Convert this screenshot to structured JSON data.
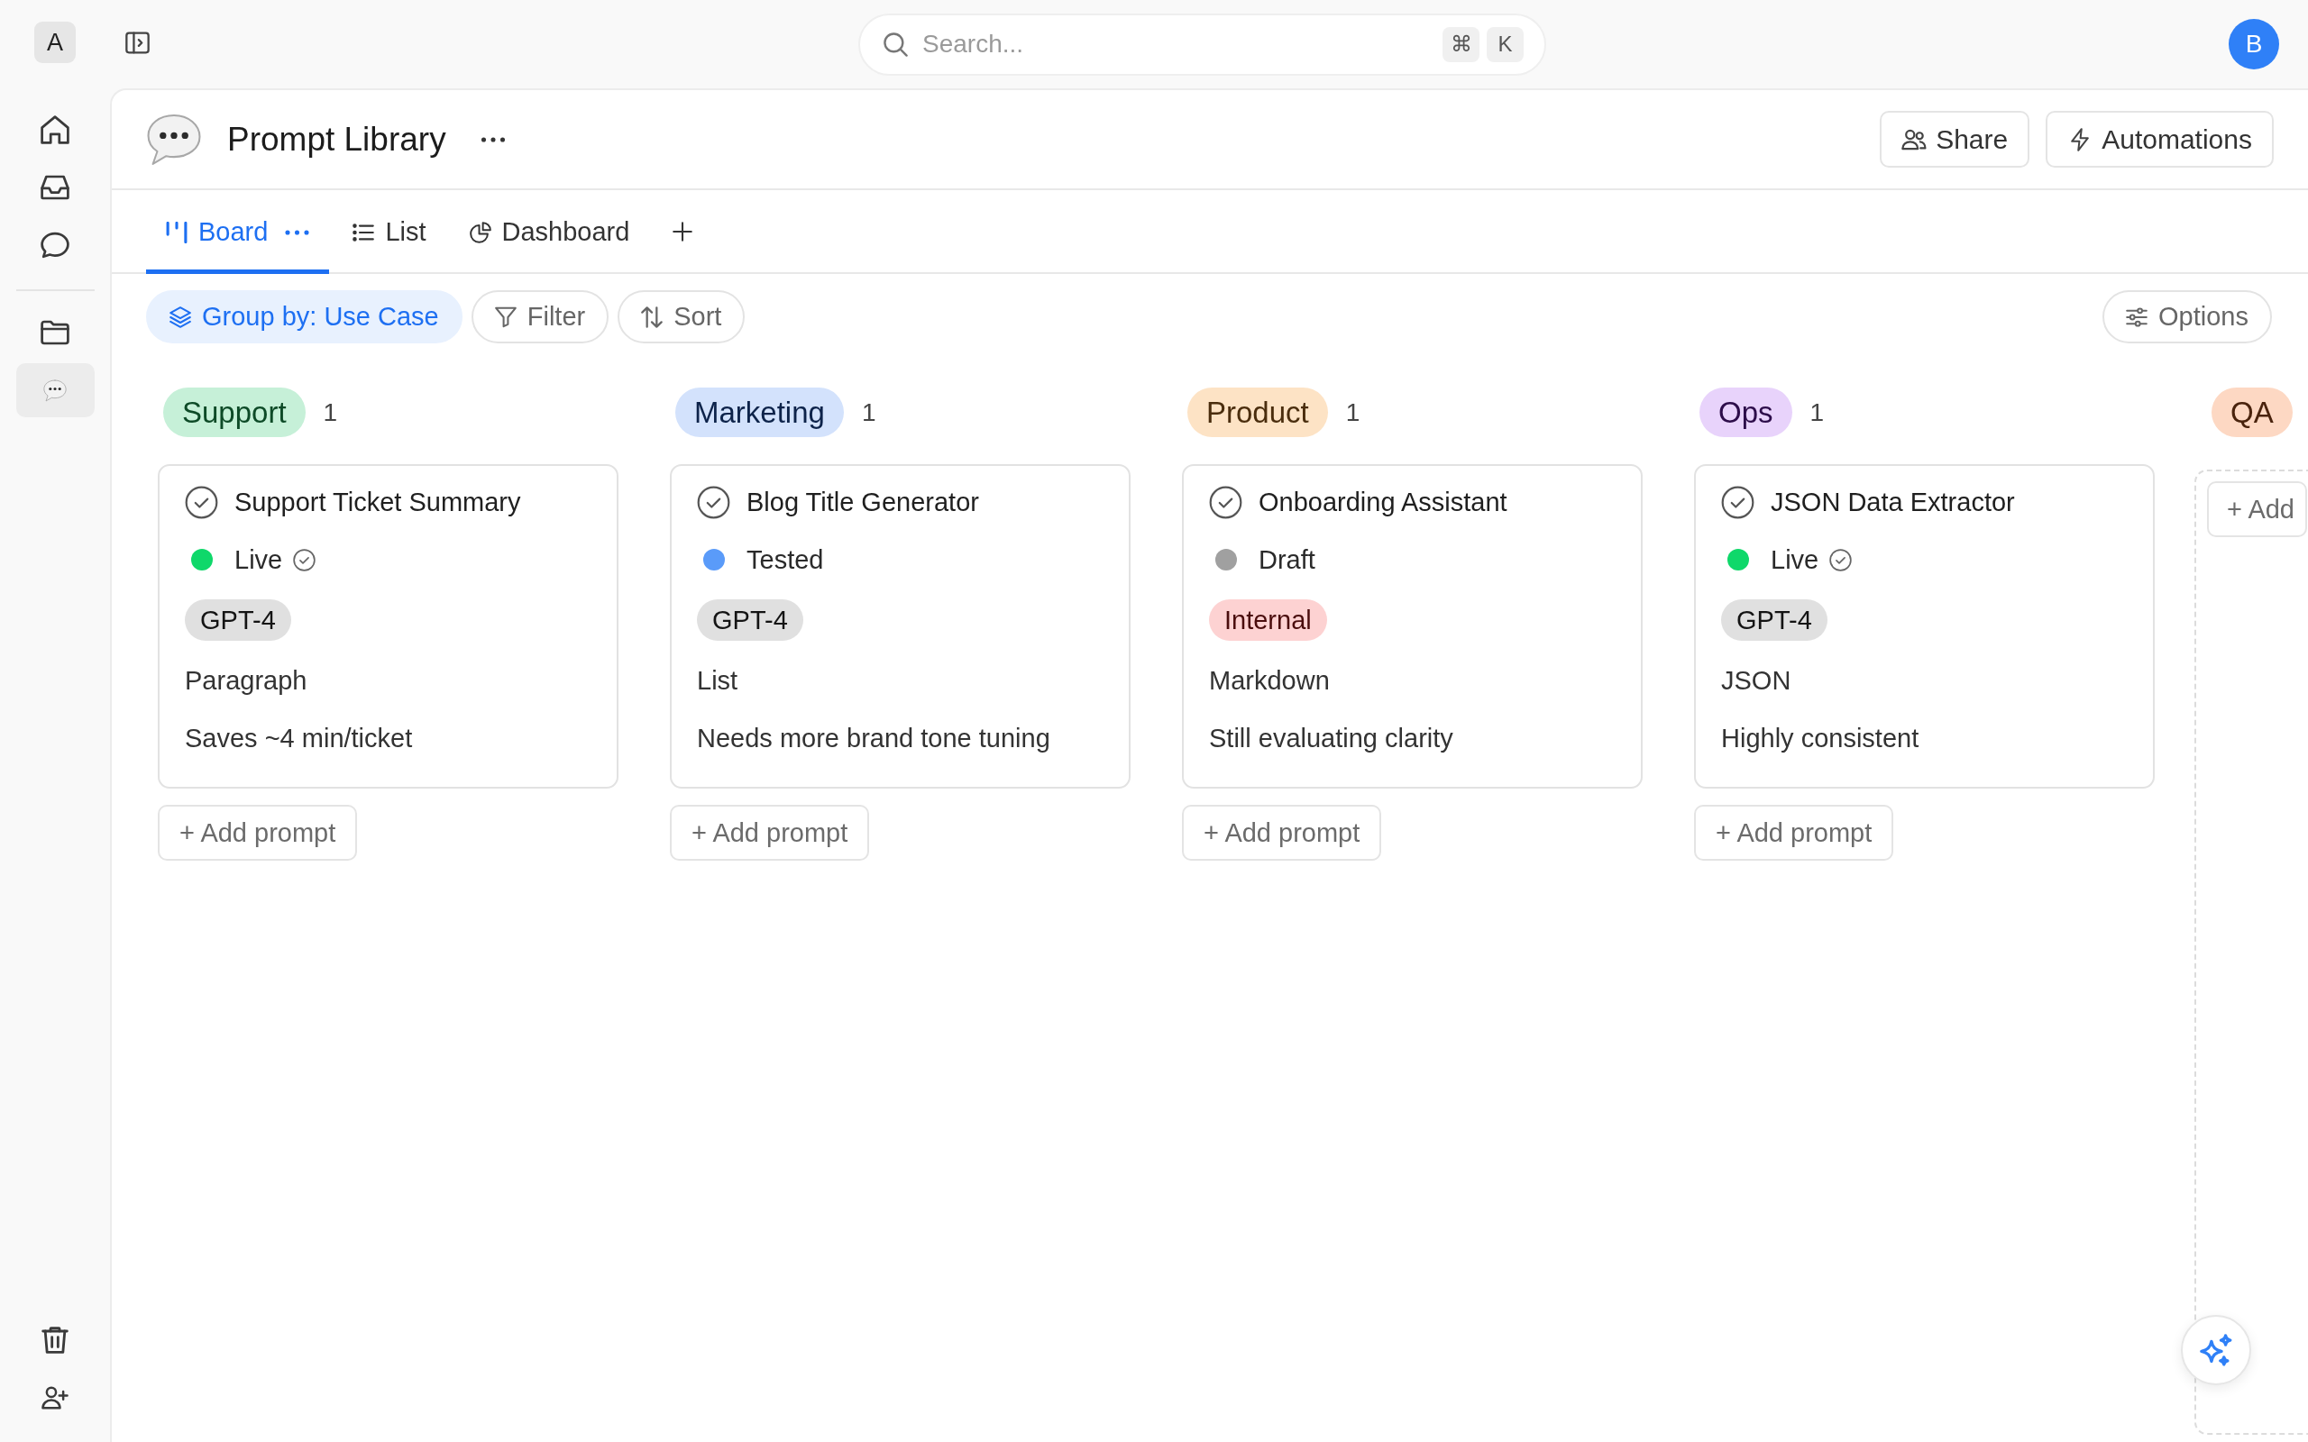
{
  "sidebar": {
    "avatar": "A",
    "nav": [
      {
        "selected": false
      },
      {
        "selected": false
      },
      {
        "selected": false
      },
      {
        "selected": false
      },
      {
        "selected": true
      }
    ]
  },
  "top_bar": {
    "search": {
      "placeholder": "Search...",
      "shortcut": [
        "⌘",
        "K"
      ]
    },
    "avatar": "B"
  },
  "page": {
    "title": "Prompt Library",
    "buttons": [
      "Share",
      "Automations"
    ]
  },
  "views": [
    {
      "label": "Board",
      "selected": true
    },
    {
      "label": "List",
      "selected": false
    },
    {
      "label": "Dashboard",
      "selected": false
    }
  ],
  "toolbar": {
    "group_by": "Group by: Use Case",
    "buttons": [
      "Filter",
      "Sort"
    ],
    "options": "Options"
  },
  "columns": [
    {
      "kind": "cards",
      "tag": "Support",
      "color": "#c6f0d8",
      "count": "1",
      "cards": [
        {
          "title": "Support Ticket Summary",
          "status": {
            "label": "Live",
            "color": "#0fd86a",
            "verified": true
          },
          "model": {
            "label": "GPT-4",
            "color": "#e0e0e0"
          },
          "format": "Paragraph",
          "note": "Saves ~4 min/ticket"
        }
      ],
      "add_button": "+ Add prompt"
    },
    {
      "kind": "cards",
      "tag": "Marketing",
      "color": "#d3e2fc",
      "count": "1",
      "cards": [
        {
          "title": "Blog Title Generator",
          "status": {
            "label": "Tested",
            "color": "#5a9bf9",
            "verified": false
          },
          "model": {
            "label": "GPT-4",
            "color": "#e0e0e0"
          },
          "format": "List",
          "note": "Needs more brand tone tuning"
        }
      ],
      "add_button": "+ Add prompt"
    },
    {
      "kind": "cards",
      "tag": "Product",
      "color": "#fde3c5",
      "count": "1",
      "cards": [
        {
          "title": "Onboarding Assistant",
          "status": {
            "label": "Draft",
            "color": "#a0a0a0",
            "verified": false
          },
          "model": {
            "label": "Internal",
            "color": "#fdd2d2"
          },
          "format": "Markdown",
          "note": "Still evaluating clarity"
        }
      ],
      "add_button": "+ Add prompt"
    },
    {
      "kind": "cards",
      "tag": "Ops",
      "color": "#e8d3fb",
      "count": "1",
      "cards": [
        {
          "title": "JSON Data Extractor",
          "status": {
            "label": "Live",
            "color": "#0fd86a",
            "verified": true
          },
          "model": {
            "label": "GPT-4",
            "color": "#e0e0e0"
          },
          "format": "JSON",
          "note": "Highly consistent"
        }
      ],
      "add_button": "+ Add prompt"
    },
    {
      "kind": "dropzone",
      "tag": "QA",
      "color": "#fdd8c3",
      "add_button": "+ Add"
    }
  ]
}
